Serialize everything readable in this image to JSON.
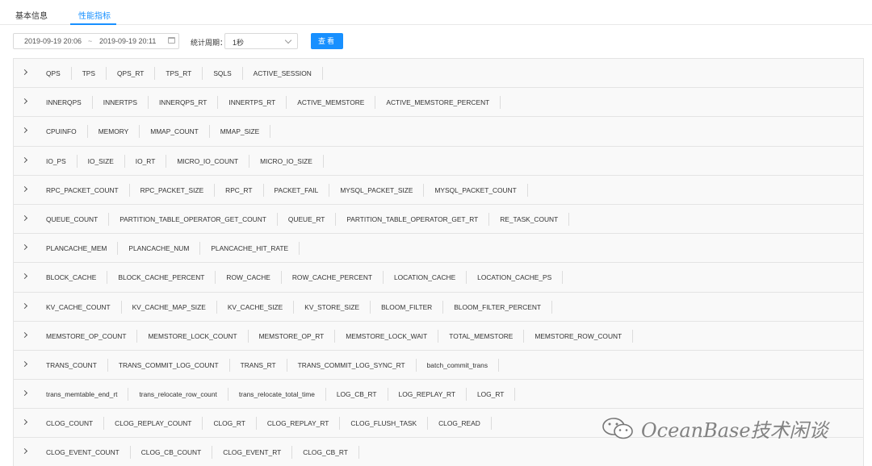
{
  "tabs": [
    {
      "label": "基本信息",
      "active": false
    },
    {
      "label": "性能指标",
      "active": true
    }
  ],
  "accent_color": "#1890ff",
  "toolbar": {
    "start_time": "2019-09-19 20:06",
    "separator": "~",
    "end_time": "2019-09-19 20:11",
    "period_label": "统计周期：",
    "period_value": "1秒",
    "view_button": "查看",
    "calendar_icon": "calendar-icon",
    "select_icon": "chevron-down-icon"
  },
  "groups": [
    {
      "metrics": [
        "QPS",
        "TPS",
        "QPS_RT",
        "TPS_RT",
        "SQLS",
        "ACTIVE_SESSION"
      ]
    },
    {
      "metrics": [
        "INNERQPS",
        "INNERTPS",
        "INNERQPS_RT",
        "INNERTPS_RT",
        "ACTIVE_MEMSTORE",
        "ACTIVE_MEMSTORE_PERCENT"
      ]
    },
    {
      "metrics": [
        "CPUINFO",
        "MEMORY",
        "MMAP_COUNT",
        "MMAP_SIZE"
      ]
    },
    {
      "metrics": [
        "IO_PS",
        "IO_SIZE",
        "IO_RT",
        "MICRO_IO_COUNT",
        "MICRO_IO_SIZE"
      ]
    },
    {
      "metrics": [
        "RPC_PACKET_COUNT",
        "RPC_PACKET_SIZE",
        "RPC_RT",
        "PACKET_FAIL",
        "MYSQL_PACKET_SIZE",
        "MYSQL_PACKET_COUNT"
      ]
    },
    {
      "metrics": [
        "QUEUE_COUNT",
        "PARTITION_TABLE_OPERATOR_GET_COUNT",
        "QUEUE_RT",
        "PARTITION_TABLE_OPERATOR_GET_RT",
        "RE_TASK_COUNT"
      ]
    },
    {
      "metrics": [
        "PLANCACHE_MEM",
        "PLANCACHE_NUM",
        "PLANCACHE_HIT_RATE"
      ]
    },
    {
      "metrics": [
        "BLOCK_CACHE",
        "BLOCK_CACHE_PERCENT",
        "ROW_CACHE",
        "ROW_CACHE_PERCENT",
        "LOCATION_CACHE",
        "LOCATION_CACHE_PS"
      ]
    },
    {
      "metrics": [
        "KV_CACHE_COUNT",
        "KV_CACHE_MAP_SIZE",
        "KV_CACHE_SIZE",
        "KV_STORE_SIZE",
        "BLOOM_FILTER",
        "BLOOM_FILTER_PERCENT"
      ]
    },
    {
      "metrics": [
        "MEMSTORE_OP_COUNT",
        "MEMSTORE_LOCK_COUNT",
        "MEMSTORE_OP_RT",
        "MEMSTORE_LOCK_WAIT",
        "TOTAL_MEMSTORE",
        "MEMSTORE_ROW_COUNT"
      ]
    },
    {
      "metrics": [
        "TRANS_COUNT",
        "TRANS_COMMIT_LOG_COUNT",
        "TRANS_RT",
        "TRANS_COMMIT_LOG_SYNC_RT",
        "batch_commit_trans"
      ]
    },
    {
      "metrics": [
        "trans_memtable_end_rt",
        "trans_relocate_row_count",
        "trans_relocate_total_time",
        "LOG_CB_RT",
        "LOG_REPLAY_RT",
        "LOG_RT"
      ]
    },
    {
      "metrics": [
        "CLOG_COUNT",
        "CLOG_REPLAY_COUNT",
        "CLOG_RT",
        "CLOG_REPLAY_RT",
        "CLOG_FLUSH_TASK",
        "CLOG_READ"
      ]
    },
    {
      "metrics": [
        "CLOG_EVENT_COUNT",
        "CLOG_CB_COUNT",
        "CLOG_EVENT_RT",
        "CLOG_CB_RT"
      ]
    }
  ],
  "group_icon": "chevron-right-icon",
  "watermark": {
    "text": "OceanBase技术闲谈",
    "icon": "wechat-icon"
  }
}
